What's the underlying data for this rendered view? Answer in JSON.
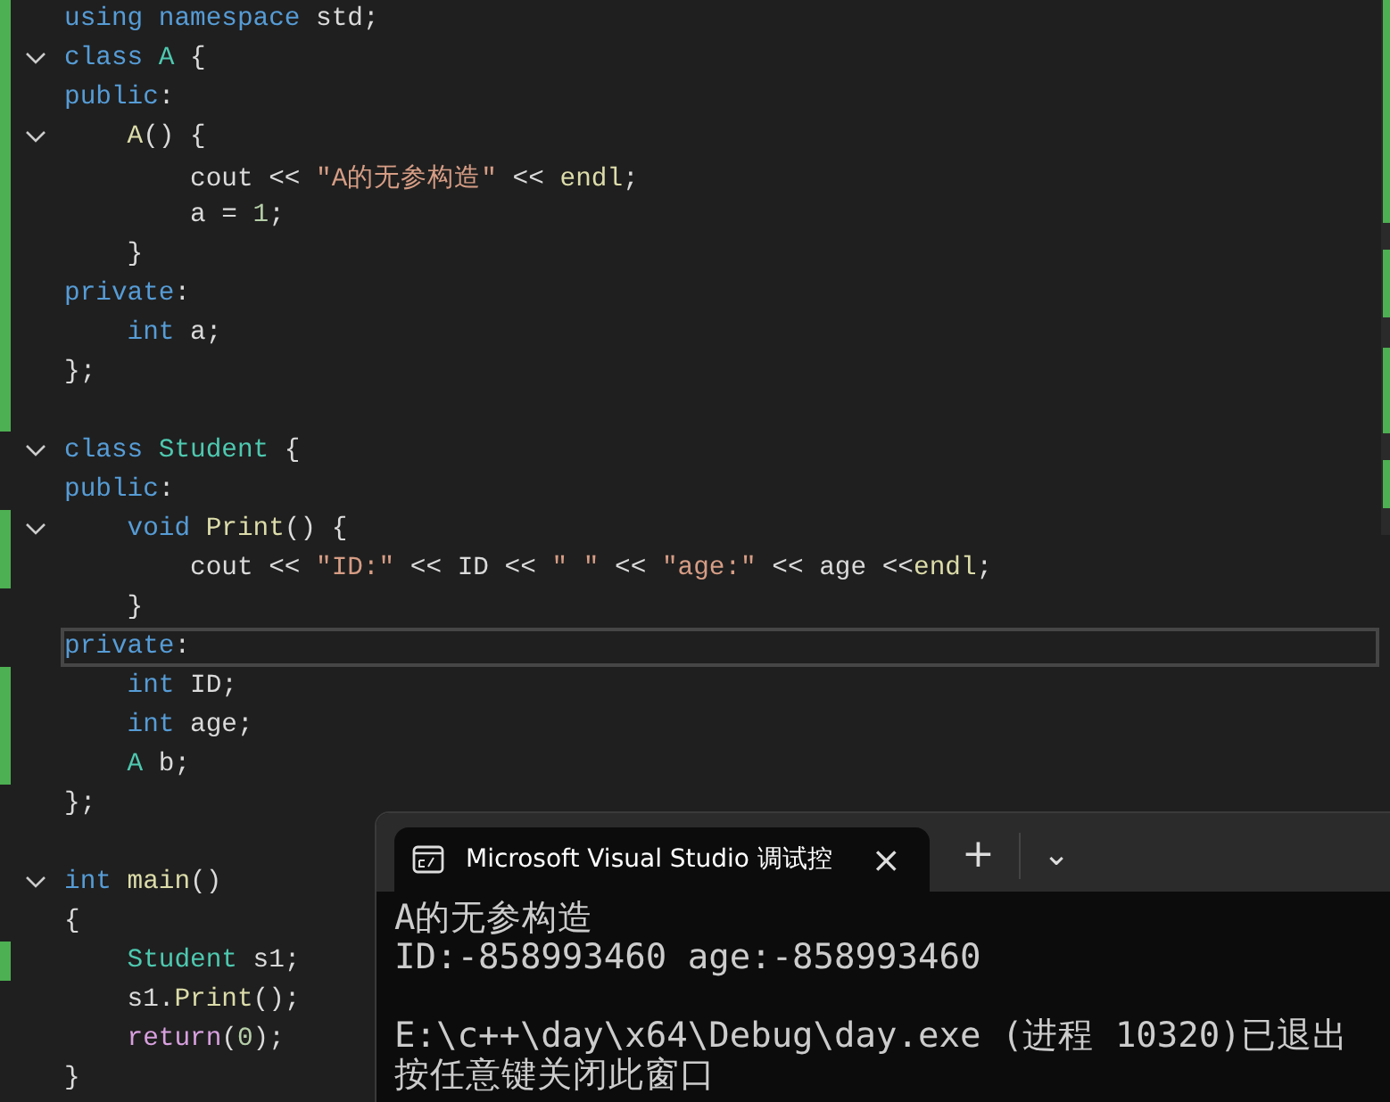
{
  "editor": {
    "lines": [
      {
        "changed": true,
        "current": false,
        "foldable": false,
        "tokens": [
          {
            "kind": "keyword",
            "text": "using namespace"
          },
          {
            "kind": "plain",
            "text": " std;"
          }
        ]
      },
      {
        "changed": true,
        "current": false,
        "foldable": true,
        "tokens": [
          {
            "kind": "keyword",
            "text": "class "
          },
          {
            "kind": "type",
            "text": "A"
          },
          {
            "kind": "plain",
            "text": " {"
          }
        ]
      },
      {
        "changed": true,
        "current": false,
        "foldable": false,
        "tokens": [
          {
            "kind": "keyword",
            "text": "public"
          },
          {
            "kind": "plain",
            "text": ":"
          }
        ]
      },
      {
        "changed": true,
        "current": false,
        "foldable": true,
        "tokens": [
          {
            "kind": "function",
            "text": "    A"
          },
          {
            "kind": "plain",
            "text": "() {"
          }
        ]
      },
      {
        "changed": true,
        "current": false,
        "foldable": false,
        "tokens": [
          {
            "kind": "plain",
            "text": "        cout << "
          },
          {
            "kind": "string",
            "text": "\"A的无参构造\""
          },
          {
            "kind": "plain",
            "text": " << "
          },
          {
            "kind": "function",
            "text": "endl"
          },
          {
            "kind": "plain",
            "text": ";"
          }
        ]
      },
      {
        "changed": true,
        "current": false,
        "foldable": false,
        "tokens": [
          {
            "kind": "plain",
            "text": "        a = "
          },
          {
            "kind": "number",
            "text": "1"
          },
          {
            "kind": "plain",
            "text": ";"
          }
        ]
      },
      {
        "changed": true,
        "current": false,
        "foldable": false,
        "tokens": [
          {
            "kind": "plain",
            "text": "    }"
          }
        ]
      },
      {
        "changed": true,
        "current": false,
        "foldable": false,
        "tokens": [
          {
            "kind": "keyword",
            "text": "private"
          },
          {
            "kind": "plain",
            "text": ":"
          }
        ]
      },
      {
        "changed": true,
        "current": false,
        "foldable": false,
        "tokens": [
          {
            "kind": "keyword",
            "text": "    int"
          },
          {
            "kind": "plain",
            "text": " a;"
          }
        ]
      },
      {
        "changed": true,
        "current": false,
        "foldable": false,
        "tokens": [
          {
            "kind": "plain",
            "text": "};"
          }
        ]
      },
      {
        "changed": true,
        "current": false,
        "foldable": false
      },
      {
        "changed": false,
        "current": false,
        "foldable": true,
        "tokens": [
          {
            "kind": "keyword",
            "text": "class "
          },
          {
            "kind": "type",
            "text": "Student"
          },
          {
            "kind": "plain",
            "text": " {"
          }
        ]
      },
      {
        "changed": false,
        "current": false,
        "foldable": false,
        "tokens": [
          {
            "kind": "keyword",
            "text": "public"
          },
          {
            "kind": "plain",
            "text": ":"
          }
        ]
      },
      {
        "changed": true,
        "current": false,
        "foldable": true,
        "tokens": [
          {
            "kind": "keyword",
            "text": "    void "
          },
          {
            "kind": "function",
            "text": "Print"
          },
          {
            "kind": "plain",
            "text": "() {"
          }
        ]
      },
      {
        "changed": true,
        "current": false,
        "foldable": false,
        "tokens": [
          {
            "kind": "plain",
            "text": "        cout << "
          },
          {
            "kind": "string",
            "text": "\"ID:\""
          },
          {
            "kind": "plain",
            "text": " << ID << "
          },
          {
            "kind": "string",
            "text": "\" \""
          },
          {
            "kind": "plain",
            "text": " << "
          },
          {
            "kind": "string",
            "text": "\"age:\""
          },
          {
            "kind": "plain",
            "text": " << age <<"
          },
          {
            "kind": "function",
            "text": "endl"
          },
          {
            "kind": "plain",
            "text": ";"
          }
        ]
      },
      {
        "changed": false,
        "current": false,
        "foldable": false,
        "tokens": [
          {
            "kind": "plain",
            "text": "    }"
          }
        ]
      },
      {
        "changed": false,
        "current": true,
        "foldable": false,
        "tokens": [
          {
            "kind": "keyword",
            "text": "private"
          },
          {
            "kind": "plain",
            "text": ":"
          }
        ]
      },
      {
        "changed": true,
        "current": false,
        "foldable": false,
        "tokens": [
          {
            "kind": "keyword",
            "text": "    int"
          },
          {
            "kind": "plain",
            "text": " ID;"
          }
        ]
      },
      {
        "changed": true,
        "current": false,
        "foldable": false,
        "tokens": [
          {
            "kind": "keyword",
            "text": "    int"
          },
          {
            "kind": "plain",
            "text": " age;"
          }
        ]
      },
      {
        "changed": true,
        "current": false,
        "foldable": false,
        "tokens": [
          {
            "kind": "type",
            "text": "    A"
          },
          {
            "kind": "plain",
            "text": " b;"
          }
        ]
      },
      {
        "changed": false,
        "current": false,
        "foldable": false,
        "tokens": [
          {
            "kind": "plain",
            "text": "};"
          }
        ]
      },
      {
        "changed": false,
        "current": false,
        "foldable": false
      },
      {
        "changed": false,
        "current": false,
        "foldable": true,
        "tokens": [
          {
            "kind": "keyword",
            "text": "int "
          },
          {
            "kind": "function",
            "text": "main"
          },
          {
            "kind": "plain",
            "text": "()"
          }
        ]
      },
      {
        "changed": false,
        "current": false,
        "foldable": false,
        "tokens": [
          {
            "kind": "plain",
            "text": "{"
          }
        ]
      },
      {
        "changed": true,
        "current": false,
        "foldable": false,
        "tokens": [
          {
            "kind": "type",
            "text": "    Student"
          },
          {
            "kind": "plain",
            "text": " s1;"
          }
        ]
      },
      {
        "changed": false,
        "current": false,
        "foldable": false,
        "tokens": [
          {
            "kind": "plain",
            "text": "    s1."
          },
          {
            "kind": "function",
            "text": "Print"
          },
          {
            "kind": "plain",
            "text": "();"
          }
        ]
      },
      {
        "changed": false,
        "current": false,
        "foldable": false,
        "tokens": [
          {
            "kind": "control",
            "text": "    return"
          },
          {
            "kind": "plain",
            "text": "("
          },
          {
            "kind": "number",
            "text": "0"
          },
          {
            "kind": "plain",
            "text": ");"
          }
        ]
      },
      {
        "changed": false,
        "current": false,
        "foldable": false,
        "tokens": [
          {
            "kind": "plain",
            "text": "}"
          }
        ]
      }
    ]
  },
  "terminal": {
    "tab": {
      "title": "Microsoft Visual Studio 调试控",
      "close": "×"
    },
    "new_tab": "+",
    "dropdown": "⌄",
    "output": [
      {
        "text": "A的无参构造",
        "gap_before": false
      },
      {
        "text": "ID:-858993460 age:-858993460",
        "gap_before": false
      },
      {
        "text": "E:\\c++\\day\\x64\\Debug\\day.exe (进程 10320)已退出",
        "gap_before": true
      },
      {
        "text": "按任意键关闭此窗口",
        "gap_before": false
      }
    ]
  }
}
